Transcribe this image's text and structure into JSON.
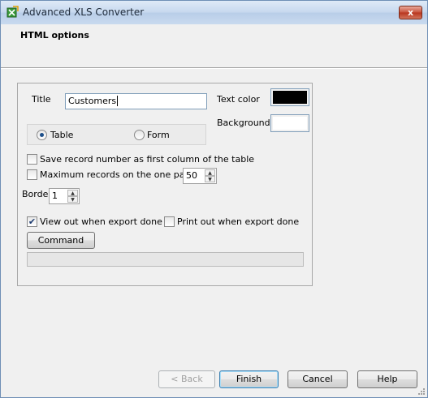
{
  "window": {
    "title": "Advanced XLS Converter",
    "close_label": "x"
  },
  "header": {
    "title": "HTML options"
  },
  "options": {
    "title_label": "Title",
    "title_value": "Customers",
    "text_color_label": "Text color",
    "text_color": "#000000",
    "background_label": "Background",
    "background_color": "#ffffff",
    "layout": {
      "options": [
        "Table",
        "Form"
      ],
      "selected": "Table"
    },
    "save_record_number_label": "Save record number as first column of the table",
    "save_record_number_checked": false,
    "max_records_label": "Maximum records on the one page",
    "max_records_checked": false,
    "max_records_value": "50",
    "border_label": "Border",
    "border_value": "1",
    "view_out_label": "View out when export done",
    "view_out_checked": true,
    "print_out_label": "Print out when export done",
    "print_out_checked": false,
    "command_line_label": "Command Line...",
    "command_line_value": "",
    "progress": 0
  },
  "footer": {
    "back_label": "< Back",
    "finish_label": "Finish",
    "cancel_label": "Cancel",
    "help_label": "Help"
  },
  "colors": {
    "accent": "#3c7fb1",
    "check_mark": "#1d3b70"
  }
}
